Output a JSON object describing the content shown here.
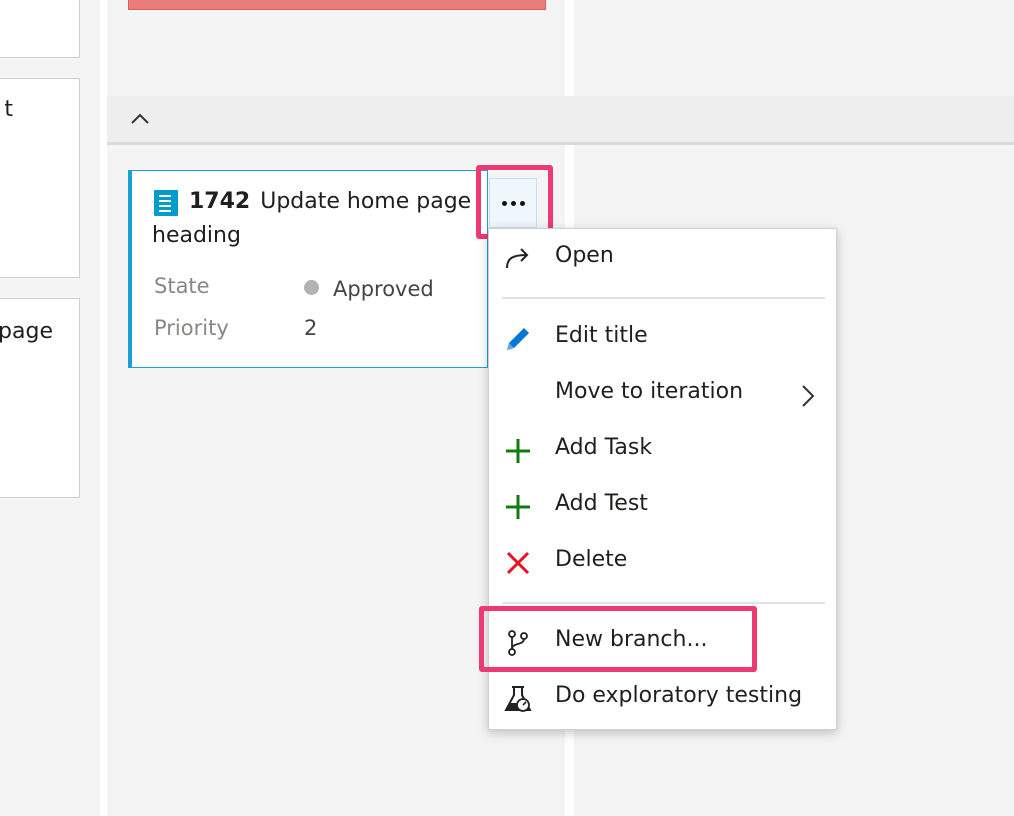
{
  "left_cards": [
    {
      "text": ""
    },
    {
      "text": "t"
    },
    {
      "text": "page"
    }
  ],
  "card": {
    "id": "1742",
    "title_line1": "Update home page",
    "title_line2": "heading",
    "fields": [
      {
        "label": "State",
        "value": "Approved",
        "status_color": "#b2b2b2"
      },
      {
        "label": "Priority",
        "value": "2"
      }
    ],
    "type_color": "#009ccc",
    "border_color": "#1ba1d6"
  },
  "menu": {
    "items": [
      {
        "label": "Open",
        "icon": "open-arrow-icon"
      },
      {
        "label": "Edit title",
        "icon": "pencil-icon"
      },
      {
        "label": "Move to iteration",
        "icon": "",
        "submenu": true
      },
      {
        "label": "Add Task",
        "icon": "plus-icon"
      },
      {
        "label": "Add Test",
        "icon": "plus-icon"
      },
      {
        "label": "Delete",
        "icon": "x-icon"
      },
      {
        "label": "New branch...",
        "icon": "branch-icon"
      },
      {
        "label": "Do exploratory testing",
        "icon": "flask-icon"
      }
    ]
  },
  "colors": {
    "highlight": "#ee3a72",
    "add_green": "#107c10",
    "delete_red": "#e81123",
    "edit_blue": "#0078d4",
    "blocked_red": "#ec7c79"
  }
}
